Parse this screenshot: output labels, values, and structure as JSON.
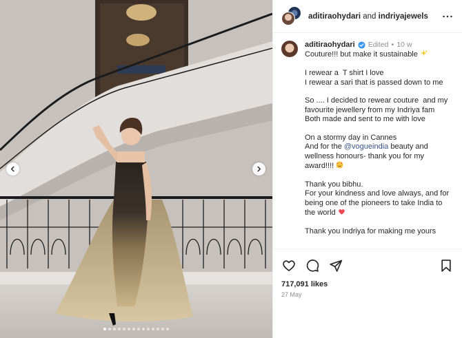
{
  "header": {
    "user_primary": "aditiraohydari",
    "joiner": "and",
    "user_secondary": "indriyajewels"
  },
  "caption": {
    "username": "aditiraohydari",
    "edited": "Edited",
    "separator": "•",
    "time_ago": "10 w",
    "lines": [
      "Couture!!! but make it sustainable",
      "",
      "I rewear a  T shirt I love",
      "I rewear a sari that is passed down to me",
      "",
      "So .... I decided to rewear couture  and my favourite jewellery from my Indriya fam",
      "Both made and sent to me with love",
      "",
      "On a stormy day in Cannes",
      "And for the",
      "",
      "Thank you bibhu.",
      "For your kindness and love always, and for being one of the pioneers to take India to the world",
      "",
      "Thank you Indriya for making me yours"
    ],
    "mention": "@vogueindia",
    "mention_tail": " beauty and wellness honours- thank you for my award!!!!"
  },
  "actions": {
    "like_icon": "heart-icon",
    "comment_icon": "comment-icon",
    "share_icon": "share-icon",
    "save_icon": "bookmark-icon"
  },
  "stats": {
    "likes": "717,091 likes",
    "date": "27 May"
  },
  "carousel": {
    "slides": 14,
    "active_index": 0
  },
  "colors": {
    "link": "#385185",
    "muted": "#8e8e8e",
    "verified": "#3897f0",
    "heart": "#ed4956"
  }
}
